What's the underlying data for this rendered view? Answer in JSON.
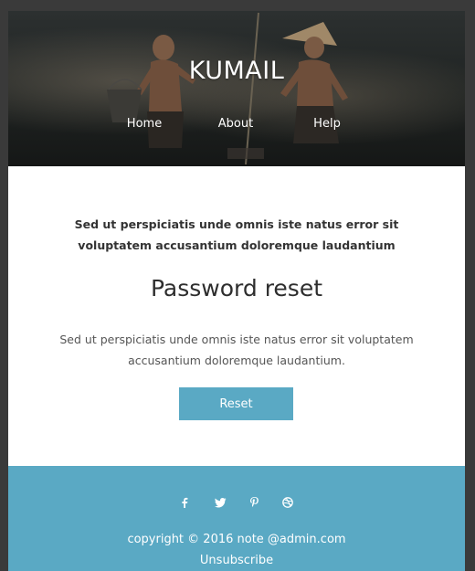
{
  "header": {
    "brand": "KUMAIL",
    "nav": [
      {
        "label": "Home"
      },
      {
        "label": "About"
      },
      {
        "label": "Help"
      }
    ]
  },
  "main": {
    "lead": "Sed ut perspiciatis unde omnis iste natus error sit voluptatem accusantium doloremque laudantium",
    "title": "Password reset",
    "description": "Sed ut perspiciatis unde omnis iste natus error sit voluptatem accusantium doloremque laudantium.",
    "reset_label": "Reset"
  },
  "footer": {
    "social_icons": [
      "facebook-icon",
      "twitter-icon",
      "pinterest-icon",
      "dribbble-icon"
    ],
    "copyright": "copyright © 2016 note @admin.com",
    "unsubscribe": "Unsubscribe"
  },
  "colors": {
    "accent": "#5aa9c4",
    "page_background": "#3a3a3a",
    "card_background": "#ffffff",
    "text_dark": "#333333"
  }
}
